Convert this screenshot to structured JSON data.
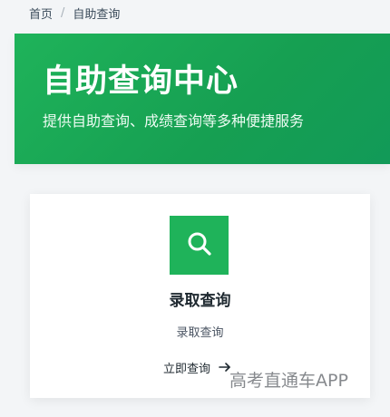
{
  "breadcrumb": {
    "items": [
      "首页",
      "自助查询"
    ],
    "separator": "/"
  },
  "hero": {
    "title": "自助查询中心",
    "subtitle": "提供自助查询、成绩查询等多种便捷服务",
    "background_color": "#1fb35a"
  },
  "card": {
    "icon": "search-icon",
    "icon_background": "#1fb35a",
    "title": "录取查询",
    "description": "录取查询",
    "link_label": "立即查询",
    "link_icon": "arrow-right-icon"
  },
  "watermark": {
    "text": "高考直通车APP"
  }
}
